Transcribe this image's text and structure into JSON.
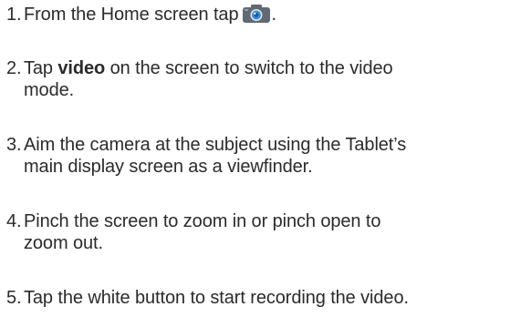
{
  "steps": [
    {
      "number": "1.",
      "before": "From the Home screen tap",
      "after": "."
    },
    {
      "number": "2.",
      "before": "Tap ",
      "bold": "video",
      "line1_rest": " on the screen to switch to the video",
      "line2": "mode."
    },
    {
      "number": "3.",
      "line1": "Aim the camera at the subject using the Tablet’s",
      "line2": "main display screen as a viewfinder."
    },
    {
      "number": "4.",
      "line1": "Pinch the screen to zoom in or pinch open to",
      "line2": "zoom out."
    },
    {
      "number": "5.",
      "line1": "Tap the white button to start recording the video."
    }
  ],
  "icons": {
    "camera": "camera-icon",
    "camera_body_color": "#5f6a72",
    "camera_lens_color": "#3a8fd6"
  }
}
